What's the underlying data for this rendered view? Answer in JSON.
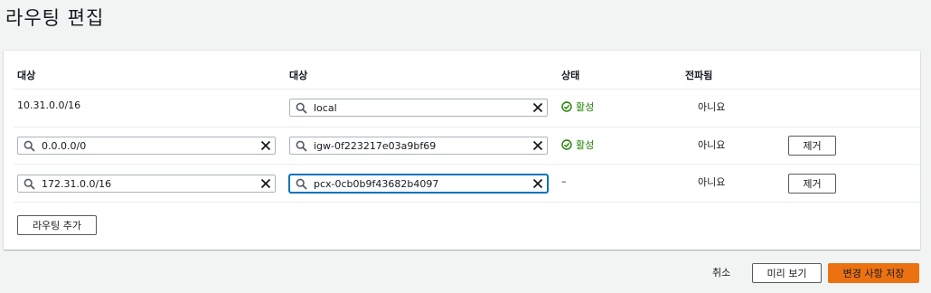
{
  "page": {
    "title": "라우팅 편집"
  },
  "table": {
    "headers": {
      "destination": "대상",
      "target": "대상",
      "status": "상태",
      "propagated": "전파됨"
    },
    "rows": [
      {
        "destination": "10.31.0.0/16",
        "target": "local",
        "status": "활성",
        "propagated": "아니요",
        "remove": ""
      },
      {
        "destination": "0.0.0.0/0",
        "target": "igw-0f223217e03a9bf69",
        "status": "활성",
        "propagated": "아니요",
        "remove": "제거"
      },
      {
        "destination": "172.31.0.0/16",
        "target": "pcx-0cb0b9f43682b4097",
        "status": "–",
        "propagated": "아니요",
        "remove": "제거"
      }
    ]
  },
  "actions": {
    "add_route": "라우팅 추가",
    "cancel": "취소",
    "preview": "미리 보기",
    "save": "변경 사항 저장"
  },
  "colors": {
    "status_active": "#1d8102",
    "primary": "#ec7211",
    "focus": "#0073bb"
  }
}
